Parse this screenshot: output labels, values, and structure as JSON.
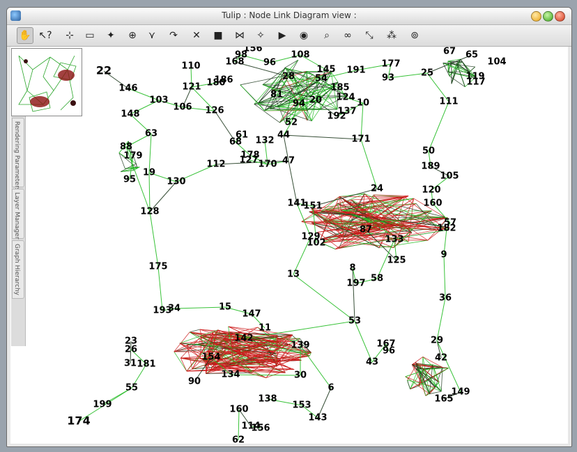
{
  "window": {
    "title": "Tulip : Node Link Diagram view :"
  },
  "toolbar": {
    "tools": [
      {
        "name": "navigate-hand-tool",
        "glyph": "✋",
        "active": true
      },
      {
        "name": "get-information-tool",
        "glyph": "↖?"
      },
      {
        "name": "select-tool",
        "glyph": "⊹"
      },
      {
        "name": "rectangle-selection-tool",
        "glyph": "▭"
      },
      {
        "name": "magic-wand-tool",
        "glyph": "✦"
      },
      {
        "name": "zoom-box-tool",
        "glyph": "⊕"
      },
      {
        "name": "add-edge-tool",
        "glyph": "⋎"
      },
      {
        "name": "edge-bend-tool",
        "glyph": "↷"
      },
      {
        "name": "delete-tool",
        "glyph": "✕"
      },
      {
        "name": "cube-tool",
        "glyph": "■"
      },
      {
        "name": "path-selection-tool",
        "glyph": "⋈"
      },
      {
        "name": "lasso-tool",
        "glyph": "✧"
      },
      {
        "name": "graph-animation-tool",
        "glyph": "▶"
      },
      {
        "name": "color-mapping-tool",
        "glyph": "◉"
      },
      {
        "name": "zoom-tool",
        "glyph": "⌕"
      },
      {
        "name": "link-tool",
        "glyph": "∞"
      },
      {
        "name": "sort-tool",
        "glyph": "⤡"
      },
      {
        "name": "neighborhood-tool",
        "glyph": "⁂"
      },
      {
        "name": "layout-tool",
        "glyph": "⊚"
      }
    ]
  },
  "sidebar": {
    "tabs": [
      "Rendering Parameters",
      "Layer Manager",
      "Graph Hierarchy"
    ]
  },
  "graph": {
    "colors": {
      "edge_green": "#22bb22",
      "edge_dark": "#1f3a1f",
      "edge_red": "#cc1a1a"
    },
    "labels": [
      {
        "t": "22",
        "big": true
      },
      {
        "t": "146"
      },
      {
        "t": "103"
      },
      {
        "t": "148"
      },
      {
        "t": "106"
      },
      {
        "t": "110"
      },
      {
        "t": "121"
      },
      {
        "t": "180"
      },
      {
        "t": "186"
      },
      {
        "t": "126"
      },
      {
        "t": "63"
      },
      {
        "t": "88"
      },
      {
        "t": "179"
      },
      {
        "t": "19"
      },
      {
        "t": "95"
      },
      {
        "t": "130"
      },
      {
        "t": "112"
      },
      {
        "t": "128"
      },
      {
        "t": "175"
      },
      {
        "t": "61"
      },
      {
        "t": "68"
      },
      {
        "t": "132"
      },
      {
        "t": "178"
      },
      {
        "t": "127"
      },
      {
        "t": "170"
      },
      {
        "t": "47"
      },
      {
        "t": "44"
      },
      {
        "t": "52"
      },
      {
        "t": "94"
      },
      {
        "t": "81"
      },
      {
        "t": "20"
      },
      {
        "t": "98"
      },
      {
        "t": "156"
      },
      {
        "t": "168"
      },
      {
        "t": "96"
      },
      {
        "t": "108"
      },
      {
        "t": "28"
      },
      {
        "t": "145"
      },
      {
        "t": "54"
      },
      {
        "t": "191"
      },
      {
        "t": "177"
      },
      {
        "t": "93"
      },
      {
        "t": "185"
      },
      {
        "t": "124"
      },
      {
        "t": "192"
      },
      {
        "t": "137"
      },
      {
        "t": "10"
      },
      {
        "t": "171"
      },
      {
        "t": "67"
      },
      {
        "t": "65"
      },
      {
        "t": "104"
      },
      {
        "t": "25"
      },
      {
        "t": "119"
      },
      {
        "t": "117"
      },
      {
        "t": "111"
      },
      {
        "t": "50"
      },
      {
        "t": "189"
      },
      {
        "t": "105"
      },
      {
        "t": "120"
      },
      {
        "t": "160"
      },
      {
        "t": "57"
      },
      {
        "t": "182"
      },
      {
        "t": "9"
      },
      {
        "t": "36"
      },
      {
        "t": "141"
      },
      {
        "t": "151"
      },
      {
        "t": "24"
      },
      {
        "t": "87"
      },
      {
        "t": "125"
      },
      {
        "t": "197"
      },
      {
        "t": "58"
      },
      {
        "t": "129"
      },
      {
        "t": "102"
      },
      {
        "t": "8"
      },
      {
        "t": "133"
      },
      {
        "t": "13"
      },
      {
        "t": "31"
      },
      {
        "t": "142"
      },
      {
        "t": "53"
      },
      {
        "t": "167"
      },
      {
        "t": "43"
      },
      {
        "t": "96"
      },
      {
        "t": "29"
      },
      {
        "t": "42"
      },
      {
        "t": "149"
      },
      {
        "t": "165"
      },
      {
        "t": "193"
      },
      {
        "t": "34"
      },
      {
        "t": "15"
      },
      {
        "t": "147"
      },
      {
        "t": "11"
      },
      {
        "t": "23"
      },
      {
        "t": "26"
      },
      {
        "t": "181"
      },
      {
        "t": "55"
      },
      {
        "t": "199"
      },
      {
        "t": "174",
        "big": true
      },
      {
        "t": "160"
      },
      {
        "t": "114"
      },
      {
        "t": "156"
      },
      {
        "t": "62"
      },
      {
        "t": "138"
      },
      {
        "t": "153"
      },
      {
        "t": "143"
      },
      {
        "t": "6"
      },
      {
        "t": "139"
      },
      {
        "t": "30"
      },
      {
        "t": "134"
      },
      {
        "t": "154"
      },
      {
        "t": "90"
      }
    ]
  }
}
